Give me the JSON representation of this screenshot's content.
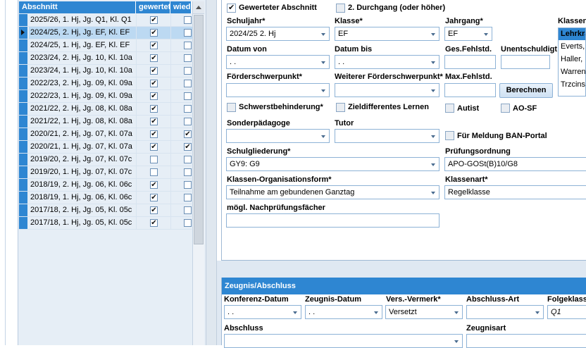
{
  "table": {
    "headers": [
      "Abschnitt",
      "gewertet",
      "wiede"
    ],
    "rows": [
      {
        "label": "2025/26, 1. Hj, Jg. Q1, Kl. Q1",
        "gewertet": true,
        "wied": false
      },
      {
        "label": "2024/25, 2. Hj, Jg. EF, Kl. EF",
        "gewertet": true,
        "wied": false,
        "selected": true
      },
      {
        "label": "2024/25, 1. Hj, Jg. EF, Kl. EF",
        "gewertet": true,
        "wied": false
      },
      {
        "label": "2023/24, 2. Hj, Jg. 10, Kl. 10a",
        "gewertet": true,
        "wied": false
      },
      {
        "label": "2023/24, 1. Hj, Jg. 10, Kl. 10a",
        "gewertet": true,
        "wied": false
      },
      {
        "label": "2022/23, 2. Hj, Jg. 09, Kl. 09a",
        "gewertet": true,
        "wied": false
      },
      {
        "label": "2022/23, 1. Hj, Jg. 09, Kl. 09a",
        "gewertet": true,
        "wied": false
      },
      {
        "label": "2021/22, 2. Hj, Jg. 08, Kl. 08a",
        "gewertet": true,
        "wied": false
      },
      {
        "label": "2021/22, 1. Hj, Jg. 08, Kl. 08a",
        "gewertet": true,
        "wied": false
      },
      {
        "label": "2020/21, 2. Hj, Jg. 07, Kl. 07a",
        "gewertet": true,
        "wied": true
      },
      {
        "label": "2020/21, 1. Hj, Jg. 07, Kl. 07a",
        "gewertet": true,
        "wied": true
      },
      {
        "label": "2019/20, 2. Hj, Jg. 07, Kl. 07c",
        "gewertet": false,
        "wied": false
      },
      {
        "label": "2019/20, 1. Hj, Jg. 07, Kl. 07c",
        "gewertet": false,
        "wied": false
      },
      {
        "label": "2018/19, 2. Hj, Jg. 06, Kl. 06c",
        "gewertet": true,
        "wied": false
      },
      {
        "label": "2018/19, 1. Hj, Jg. 06, Kl. 06c",
        "gewertet": true,
        "wied": false
      },
      {
        "label": "2017/18, 2. Hj, Jg. 05, Kl. 05c",
        "gewertet": true,
        "wied": false
      },
      {
        "label": "2017/18, 1. Hj, Jg. 05, Kl. 05c",
        "gewertet": true,
        "wied": false
      }
    ]
  },
  "form": {
    "gewerteter": "Gewerteter Abschnitt",
    "durchgang": "2. Durchgang (oder höher)",
    "schuljahr_label": "Schuljahr*",
    "schuljahr_value": "2024/25 2. Hj",
    "klasse_label": "Klasse*",
    "klasse_value": "EF",
    "jahrgang_label": "Jahrgang*",
    "jahrgang_value": "EF",
    "klassenlehrer_label": "Klassenl",
    "klassenlehrer_header": "Lehrkra",
    "klassenlehrer_items": [
      "Everts,",
      "Haller,",
      "Warren",
      "Trzcins"
    ],
    "datum_von_label": "Datum von",
    "datum_von_value": " . .",
    "datum_bis_label": "Datum bis",
    "datum_bis_value": " . .",
    "fehlstd_label": "Ges.Fehlstd.",
    "unentschuldigt_label": "Unentschuldigt",
    "foerder_label": "Förderschwerpunkt*",
    "weiterer_label": "Weiterer Förderschwerpunkt*",
    "maxfehl_label": "Max.Fehlstd.",
    "berechnen": "Berechnen",
    "schwerst": "Schwerstbehinderung*",
    "zieldiff": "Zieldifferentes Lernen",
    "autist": "Autist",
    "aosf": "AO-SF",
    "sonder_label": "Sonderpädagoge",
    "tutor_label": "Tutor",
    "ban": "Für Meldung BAN-Portal",
    "schulgl_label": "Schulgliederung*",
    "schulgl_value": "GY9: G9",
    "pruef_label": "Prüfungsordnung",
    "pruef_value": "APO-GOSt(B)10/G8",
    "orgform_label": "Klassen-Organisationsform*",
    "orgform_value": "Teilnahme am gebundenen Ganztag",
    "klassenart_label": "Klassenart*",
    "klassenart_value": "Regelklasse",
    "nachpruef_label": "mögl. Nachprüfungsfächer"
  },
  "zeugnis": {
    "title": "Zeugnis/Abschluss",
    "konferenz_label": "Konferenz-Datum",
    "konferenz_value": " . .",
    "zeugnis_label": "Zeugnis-Datum",
    "zeugnis_value": " . .",
    "vers_label": "Vers.-Vermerk*",
    "vers_value": "Versetzt",
    "abschlussart_label": "Abschluss-Art",
    "folge_label": "Folgeklasse",
    "folge_value": "Q1",
    "abschluss_label": "Abschluss",
    "zeugnisart_label": "Zeugnisart"
  }
}
